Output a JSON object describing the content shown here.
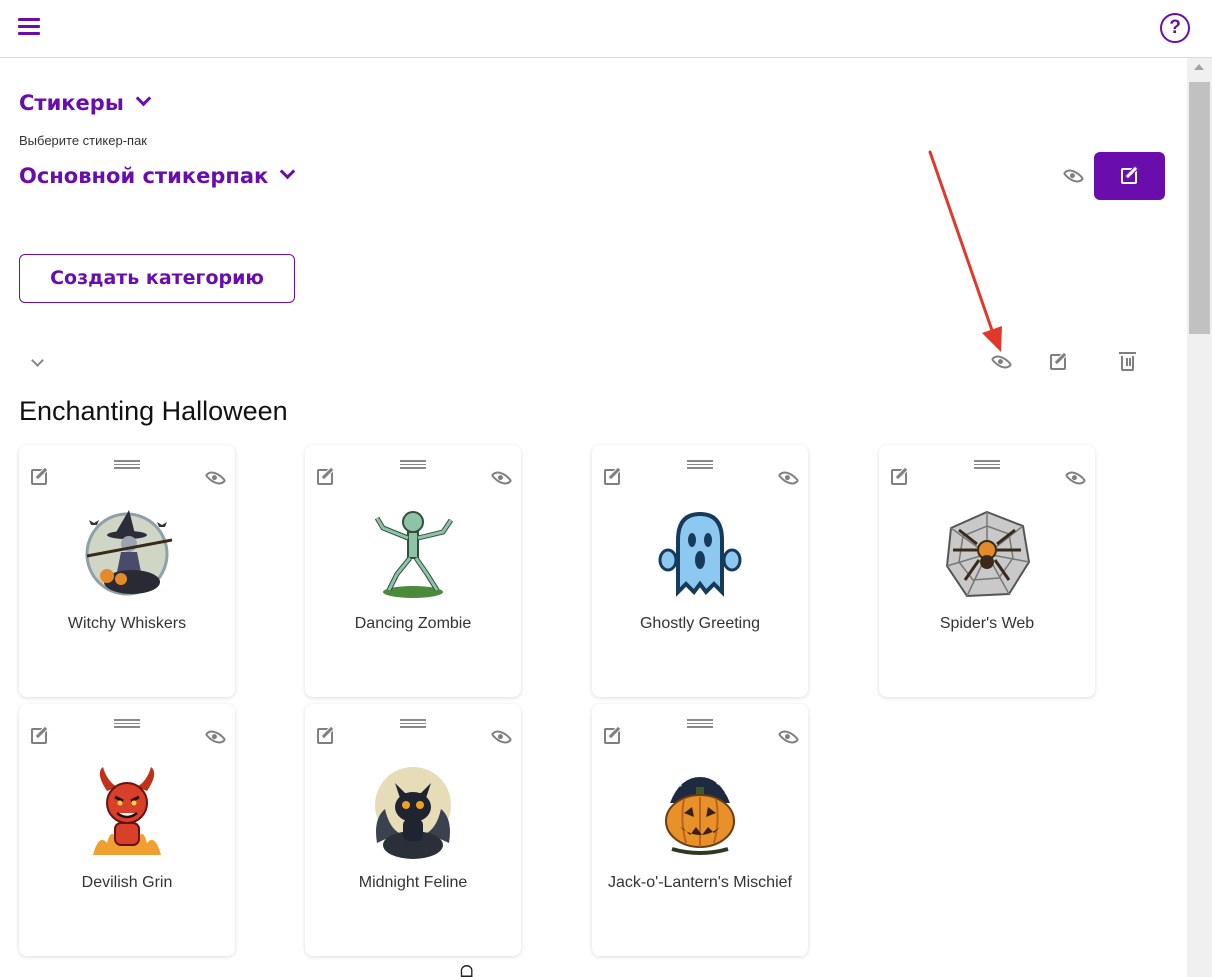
{
  "header": {
    "menu_icon": "hamburger-menu-icon",
    "help_icon": "question-circle-icon",
    "help_glyph": "?"
  },
  "section": {
    "title": "Стикеры",
    "pack_hint": "Выберите стикер-пак",
    "pack_name": "Основной стикерпак"
  },
  "actions": {
    "create_category": "Создать категорию"
  },
  "category": {
    "title": "Enchanting Halloween",
    "stickers": [
      {
        "label": "Witchy Whiskers",
        "icon": "witch-on-cat-image"
      },
      {
        "label": "Dancing Zombie",
        "icon": "zombie-skeleton-image"
      },
      {
        "label": "Ghostly Greeting",
        "icon": "ghost-image"
      },
      {
        "label": "Spider's Web",
        "icon": "spider-web-image"
      },
      {
        "label": "Devilish Grin",
        "icon": "devil-image"
      },
      {
        "label": "Midnight Feline",
        "icon": "black-cat-image"
      },
      {
        "label": "Jack-o'-Lantern's Mischief",
        "icon": "pumpkin-image"
      }
    ]
  },
  "footer_glyph": "ᗝ",
  "colors": {
    "accent": "#6a0dad",
    "icon_gray": "#7f7f7f",
    "annotation_arrow": "#e0392b"
  }
}
